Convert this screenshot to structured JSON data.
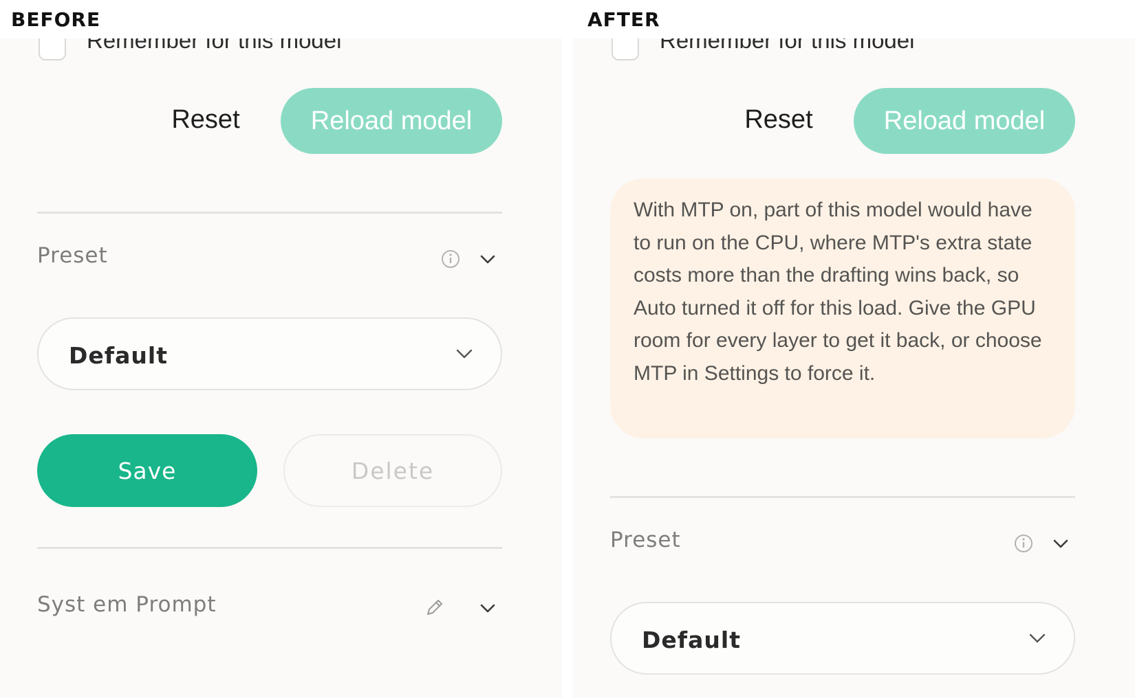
{
  "before": {
    "heading": "BEFORE",
    "remember_label": "Remember for this model",
    "reset_label": "Reset",
    "reload_label": "Reload model",
    "preset_label": "Preset",
    "preset_value": "Default",
    "save_label": "Save",
    "delete_label": "Delete",
    "system_prompt_label": "Syst em Prompt"
  },
  "after": {
    "heading": "AFTER",
    "remember_label": "Remember for this model",
    "reset_label": "Reset",
    "reload_label": "Reload model",
    "warning_text": "With MTP on, part of this model would have to run on the CPU, where MTP's extra state costs more than the drafting wins back, so Auto turned it off for this load. Give the GPU room for every layer to get it back, or choose MTP in Settings to force it.",
    "preset_label": "Preset",
    "preset_value": "Default"
  },
  "icons": {
    "info": "info-icon",
    "chevron": "chevron-down-icon",
    "edit": "pencil-icon"
  },
  "colors": {
    "accent": "#18b68a",
    "accent_light": "#8bdbc4",
    "warning_bg": "#fdf2e5",
    "panel_bg": "#fbfaf8"
  }
}
